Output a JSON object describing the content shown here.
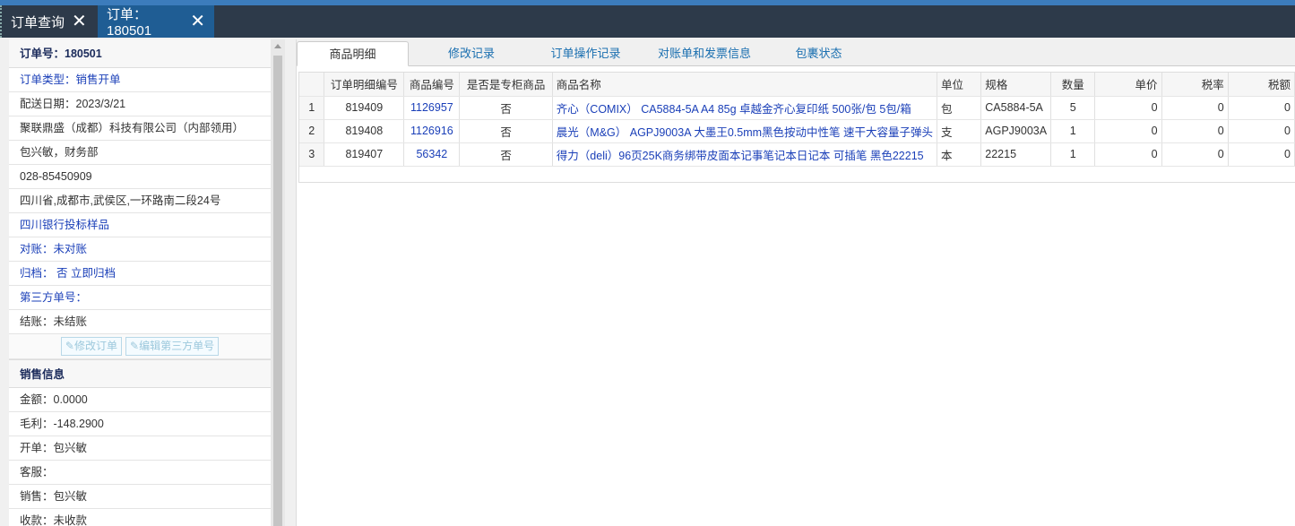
{
  "tabs": [
    {
      "label": "订单查询"
    },
    {
      "label": "订单：180501"
    }
  ],
  "order": {
    "header": "订单号：180501",
    "type": "订单类型：销售开单",
    "delivery_date": "配送日期：2023/3/21",
    "company": "聚联鼎盛（成都）科技有限公司（内部领用）",
    "contact": "包兴敏，财务部",
    "phone": "028-85450909",
    "address": "四川省,成都市,武侯区,一环路南二段24号",
    "project": "四川银行投标样品",
    "reconcile": "对账：未对账",
    "archive": "归档： 否 立即归档",
    "third_party_no": "第三方单号：",
    "settle": "结账：未结账",
    "edit_order_button": "修改订单",
    "edit_third_party_button": "编辑第三方单号"
  },
  "sales": {
    "header": "销售信息",
    "amount": "金额：0.0000",
    "profit": "毛利：-148.2900",
    "opener": "开单：包兴敏",
    "service": "客服：",
    "seller": "销售：包兴敏",
    "collector": "收款：未收款"
  },
  "detail_tabs": [
    "商品明细",
    "修改记录",
    "订单操作记录",
    "对账单和发票信息",
    "包裹状态"
  ],
  "grid": {
    "columns": [
      "订单明细编号",
      "商品编号",
      "是否是专柜商品",
      "商品名称",
      "单位",
      "规格",
      "数量",
      "单价",
      "税率",
      "税额"
    ],
    "rows": [
      {
        "idx": "1",
        "detail_no": "819409",
        "product_no": "1126957",
        "counter": "否",
        "name": "齐心（COMIX） CA5884-5A A4 85g 卓越金齐心复印纸 500张/包 5包/箱",
        "unit": "包",
        "spec": "CA5884-5A",
        "qty": "5",
        "price": "0",
        "tax_rate": "0",
        "tax": "0"
      },
      {
        "idx": "2",
        "detail_no": "819408",
        "product_no": "1126916",
        "counter": "否",
        "name": "晨光（M&G） AGPJ9003A 大墨王0.5mm黑色按动中性笔 速干大容量子弹头",
        "unit": "支",
        "spec": "AGPJ9003A",
        "qty": "1",
        "price": "0",
        "tax_rate": "0",
        "tax": "0"
      },
      {
        "idx": "3",
        "detail_no": "819407",
        "product_no": "56342",
        "counter": "否",
        "name": "得力（deli）96页25K商务绑带皮面本记事笔记本日记本 可插笔 黑色22215",
        "unit": "本",
        "spec": "22215",
        "qty": "1",
        "price": "0",
        "tax_rate": "0",
        "tax": "0"
      }
    ]
  }
}
